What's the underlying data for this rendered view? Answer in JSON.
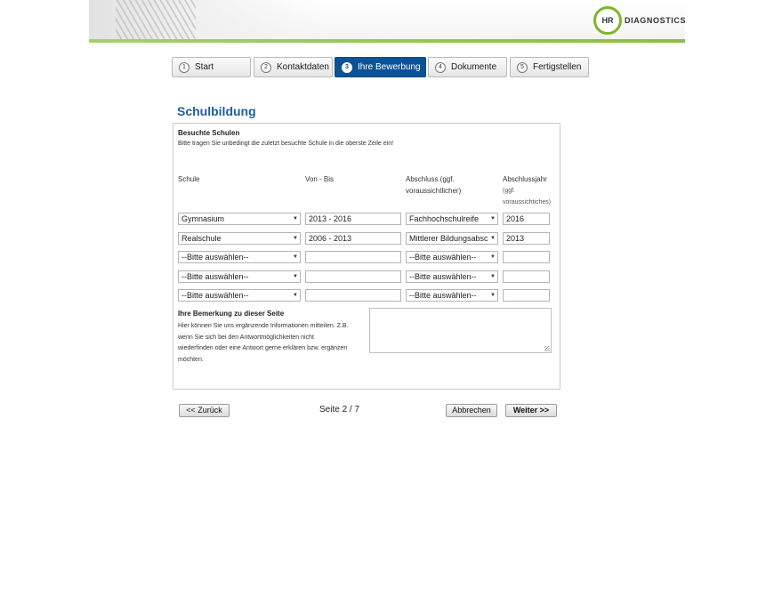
{
  "logo": {
    "ring_text": "HR",
    "text": "DIAGNOSTICS"
  },
  "steps": [
    {
      "num": "1",
      "label": "Start"
    },
    {
      "num": "2",
      "label": "Kontaktdaten"
    },
    {
      "num": "3",
      "label": "Ihre Bewerbung"
    },
    {
      "num": "4",
      "label": "Dokumente"
    },
    {
      "num": "5",
      "label": "Fertigstellen"
    }
  ],
  "page_title": "Schulbildung",
  "section": {
    "title": "Besuchte Schulen",
    "hint": "Bitte tragen Sie unbedingt die zuletzt besuchte Schule in die oberste Zeile ein!"
  },
  "columns": {
    "schule": "Schule",
    "von_bis": "Von - Bis",
    "abschluss_1": "Abschluss (ggf.",
    "abschluss_2": "voraussichtlicher)",
    "jahr": "Abschlussjahr",
    "jahr_sub_1": "(ggf.",
    "jahr_sub_2": "voraussichtiches)"
  },
  "rows": [
    {
      "schule": "Gymnasium",
      "von_bis": "2013 - 2016",
      "abschluss": "Fachhochschulreife",
      "jahr": "2016"
    },
    {
      "schule": "Realschule",
      "von_bis": "2006 - 2013",
      "abschluss": "Mittlerer Bildungsabschluss",
      "jahr": "2013"
    },
    {
      "schule": "--Bitte auswählen--",
      "von_bis": "",
      "abschluss": "--Bitte auswählen--",
      "jahr": ""
    },
    {
      "schule": "--Bitte auswählen--",
      "von_bis": "",
      "abschluss": "--Bitte auswählen--",
      "jahr": ""
    },
    {
      "schule": "--Bitte auswählen--",
      "von_bis": "",
      "abschluss": "--Bitte auswählen--",
      "jahr": ""
    }
  ],
  "remark": {
    "title": "Ihre Bemerkung zu dieser Seite",
    "line1": "Hier können Sie uns ergänzende Informationen mitteilen. Z.B.",
    "line2": "wenn Sie sich bei den Antwortmöglichkeiten nicht",
    "line3": "wiederfinden oder eine Antwort gerne erklären bzw. ergänzen",
    "line4": "möchten.",
    "value": ""
  },
  "nav": {
    "back": "<< Zurück",
    "page_info": "Seite 2 / 7",
    "cancel": "Abbrechen",
    "next": "Weiter >>"
  },
  "colors": {
    "accent": "#0b5394",
    "title": "#1f5f9b",
    "brand_green": "#7fb627"
  }
}
